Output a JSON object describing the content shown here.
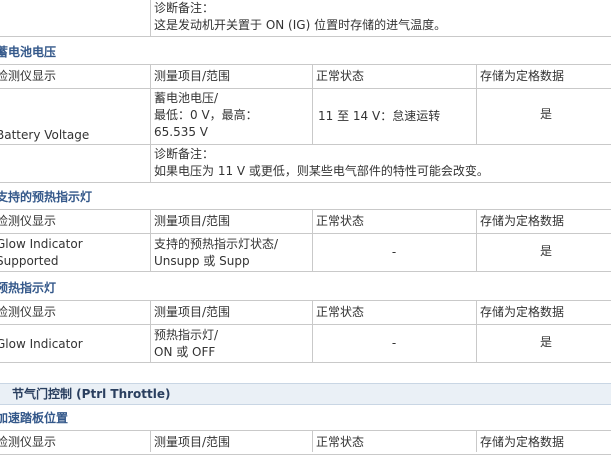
{
  "top_note": {
    "label": "诊断备注：",
    "text": "这是发动机开关置于 ON (IG) 位置时存储的进气温度。"
  },
  "headers": {
    "tester": "检测仪显示",
    "range": "测量项目/范围",
    "normal": "正常状态",
    "freeze": "存储为定格数据"
  },
  "battery": {
    "section_title": "蓄电池电压",
    "tester_display": "Battery Voltage",
    "range_line1": "蓄电池电压/",
    "range_line2": "最低：0 V，最高：",
    "range_line3": "65.535 V",
    "normal": "11 至 14 V：怠速运转",
    "freeze": "是",
    "note_label": "诊断备注：",
    "note_text": "如果电压为 11 V 或更低，则某些电气部件的特性可能会改变。"
  },
  "glow_supported": {
    "section_title": "支持的预热指示灯",
    "tester_line1": "Glow Indicator",
    "tester_line2": "Supported",
    "range_line1": "支持的预热指示灯状态/",
    "range_line2": "Unsupp 或 Supp",
    "normal": "-",
    "freeze": "是"
  },
  "glow": {
    "section_title": "预热指示灯",
    "tester_display": "Glow Indicator",
    "range_line1": "预热指示灯/",
    "range_line2": "ON 或 OFF",
    "normal": "-",
    "freeze": "是"
  },
  "throttle_band": "节气门控制 (Ptrl Throttle)",
  "accel": {
    "section_title": "加速踏板位置"
  }
}
